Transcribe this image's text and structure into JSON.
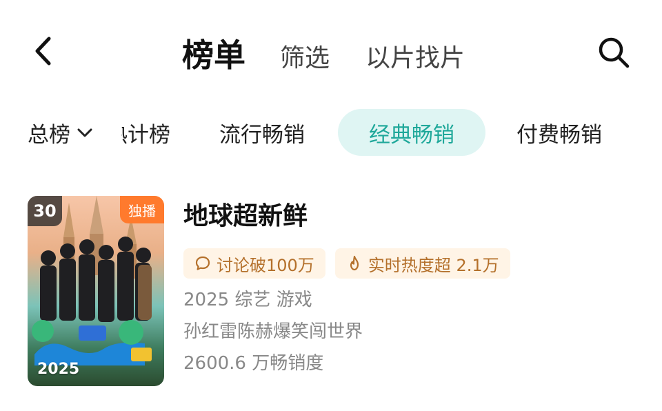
{
  "nav": {
    "tabs": [
      "榜单",
      "筛选",
      "以片找片"
    ]
  },
  "filters": {
    "dropdown_label": "总榜",
    "partial_chip": "热计榜",
    "chips": [
      "流行畅销",
      "经典畅销",
      "付费畅销"
    ],
    "active_chip": "经典畅销",
    "active_color": "#1fa89a"
  },
  "items": [
    {
      "rank": "30",
      "badge": "独播",
      "poster_year": "2025",
      "title": "地球超新鲜",
      "tags": [
        {
          "icon": "chat-bubble-icon",
          "text": "讨论破100万"
        },
        {
          "icon": "flame-icon",
          "text": "实时热度超 2.1万"
        }
      ],
      "meta_line": "2025 综艺 游戏",
      "description": "孙红雷陈赫爆笑闯世界",
      "sales": "2600.6 万畅销度"
    }
  ]
}
